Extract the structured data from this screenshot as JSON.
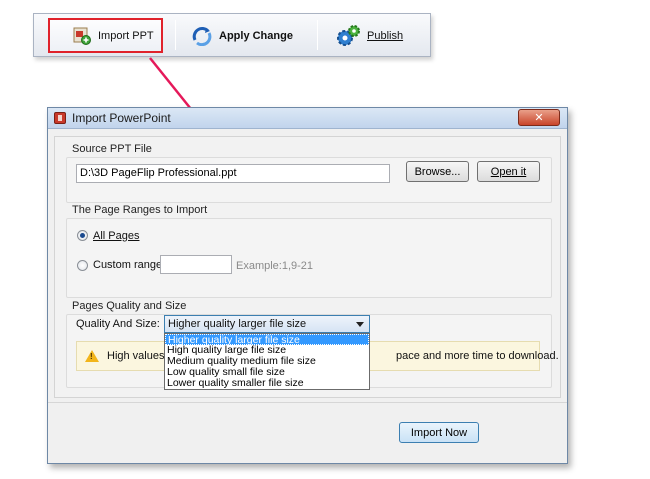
{
  "toolbar": {
    "import_label": "Import PPT",
    "apply_label": "Apply Change",
    "publish_label": "Publish"
  },
  "dialog": {
    "title": "Import PowerPoint",
    "close_symbol": "✕",
    "source": {
      "group_label": "Source PPT File",
      "path": "D:\\3D PageFlip Professional.ppt",
      "browse_label": "Browse...",
      "open_label": "Open it"
    },
    "ranges": {
      "group_label": "The Page Ranges to Import",
      "all_pages_label": "All Pages",
      "all_pages_selected": true,
      "custom_label": "Custom range:",
      "custom_value": "",
      "example": "Example:1,9-21"
    },
    "quality": {
      "group_label": "Pages Quality and Size",
      "field_label": "Quality And Size:",
      "selected": "Higher quality larger file size",
      "options": [
        "Higher quality larger file size",
        "High quality large file size",
        "Medium quality medium file size",
        "Low quality small file size",
        "Lower quality smaller file size"
      ],
      "warning_left": "High values pro",
      "warning_right": "pace and more time to download."
    },
    "import_now_label": "Import Now"
  },
  "colors": {
    "highlight_red": "#e0222b",
    "selection_blue": "#3399ff",
    "warning_yellow": "#f2b51b"
  }
}
